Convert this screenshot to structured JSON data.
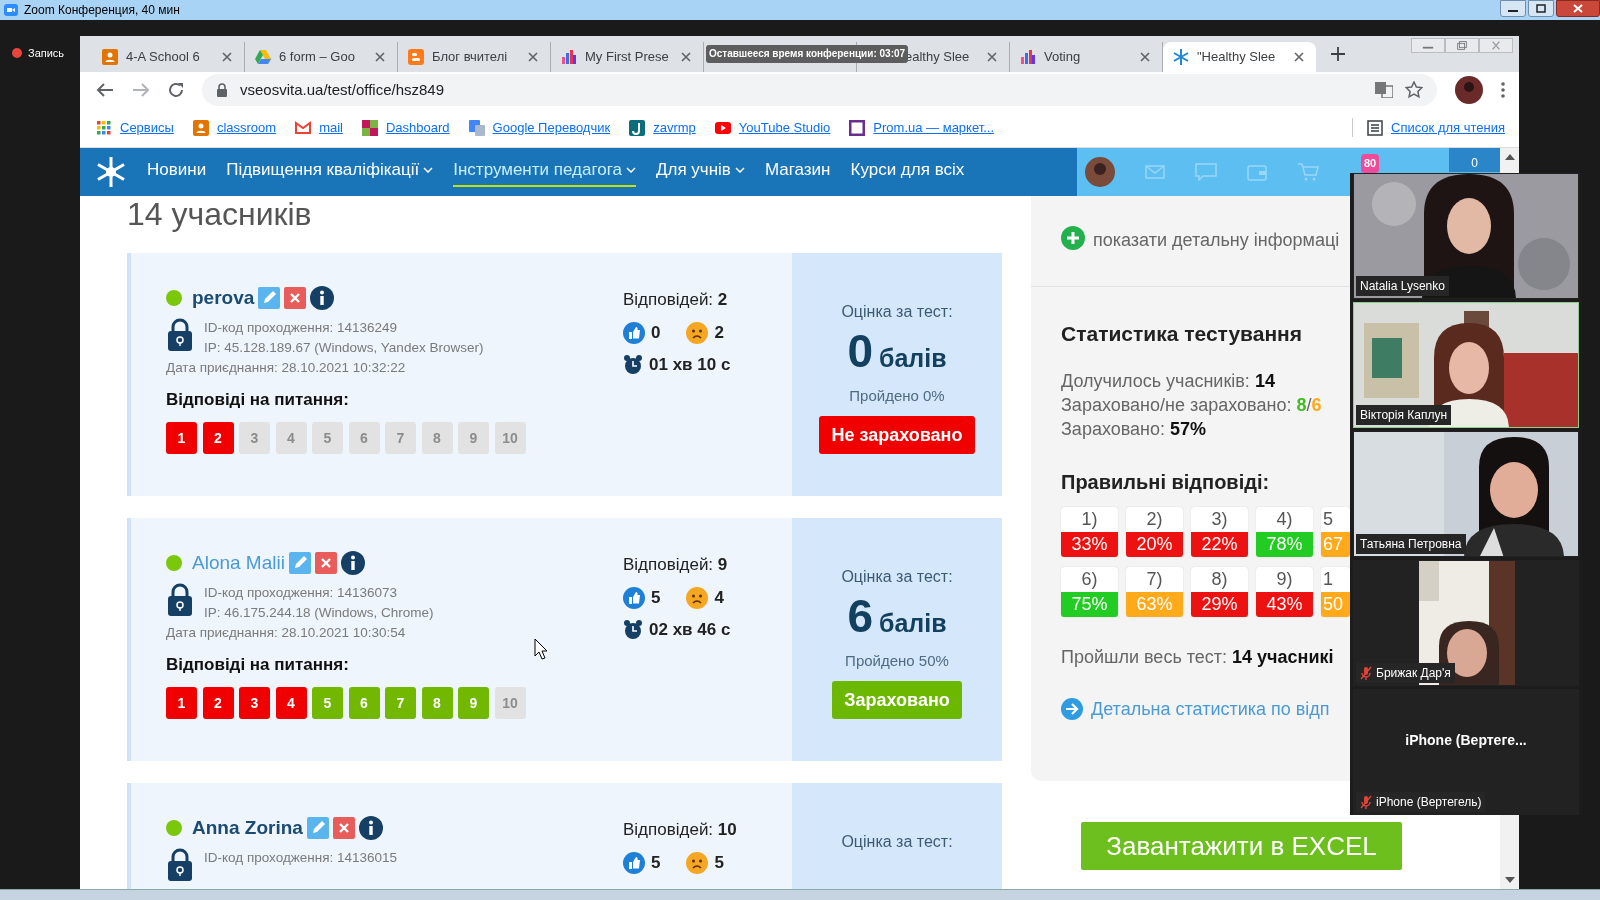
{
  "zoom_window": {
    "title": "Zoom Конференция, 40 мин",
    "recording": "Запись",
    "time_left": "Оставшееся время конференции: 03:07"
  },
  "browser": {
    "tabs": [
      {
        "kind": "classroom",
        "title": "4-A School 6",
        "selected": false
      },
      {
        "kind": "drive",
        "title": "6 form – Goo",
        "selected": false
      },
      {
        "kind": "blogger",
        "title": "Блог вчителі",
        "selected": false
      },
      {
        "kind": "chart",
        "title": "My First Prese",
        "selected": false
      },
      {
        "selected": false
      },
      {
        "title": "ealthy Slee",
        "selected": false
      },
      {
        "kind": "chart",
        "title": "Voting",
        "selected": false
      },
      {
        "kind": "snowflake",
        "title": "\"Healthy Slee",
        "selected": true
      }
    ],
    "address": "vseosvita.ua/test/office/hsz849",
    "bookmarks": [
      {
        "kind": "apps",
        "label": "Сервисы"
      },
      {
        "kind": "classroom",
        "label": "classroom"
      },
      {
        "kind": "gmail",
        "label": "mail"
      },
      {
        "kind": "dashboard",
        "label": "Dashboard"
      },
      {
        "kind": "translate",
        "label": "Google Переводчик"
      },
      {
        "kind": "zavrmp",
        "label": "zavrmp"
      },
      {
        "kind": "youtube",
        "label": "YouTube Studio"
      },
      {
        "kind": "prom",
        "label": "Prom.ua — маркет..."
      }
    ],
    "reading_list": "Список для чтения"
  },
  "site": {
    "nav": [
      {
        "label": "Новини",
        "dropdown": false,
        "selected": false
      },
      {
        "label": "Підвищення кваліфікації",
        "dropdown": true,
        "selected": false
      },
      {
        "label": "Інструменти педагога",
        "dropdown": true,
        "selected": true
      },
      {
        "label": "Для учнів",
        "dropdown": true,
        "selected": false
      },
      {
        "label": "Магазин",
        "dropdown": false,
        "selected": false
      },
      {
        "label": "Курси для всіх",
        "dropdown": false,
        "selected": false
      }
    ],
    "notifications": "80",
    "cart_count": "0"
  },
  "participants_heading": "14 учасників",
  "students": [
    {
      "name": "perova",
      "highlighted": false,
      "online": true,
      "id_code": "ID-код проходження: 14136249",
      "ip": "IP: 45.128.189.67 (Windows, Yandex Browser)",
      "joined": "Дата приєднання: 28.10.2021 10:32:22",
      "answers_label": "Відповіді на питання:",
      "questions": [
        {
          "label": "1",
          "kind": "wrong"
        },
        {
          "label": "2",
          "kind": "wrong"
        },
        {
          "label": "3",
          "kind": "none"
        },
        {
          "label": "4",
          "kind": "none"
        },
        {
          "label": "5",
          "kind": "none"
        },
        {
          "label": "6",
          "kind": "none"
        },
        {
          "label": "7",
          "kind": "none"
        },
        {
          "label": "8",
          "kind": "none"
        },
        {
          "label": "9",
          "kind": "none"
        },
        {
          "label": "10",
          "kind": "none"
        }
      ],
      "responses_label": "Відповідей:",
      "responses": "2",
      "likes": "0",
      "dislikes": "2",
      "time": "01 хв 10 с",
      "grade_label": "Оцінка за тест:",
      "score": "0",
      "score_unit": "балів",
      "passed": "Пройдено 0%",
      "verdict": {
        "label": "Не зараховано",
        "passed": false
      }
    },
    {
      "name": "Alona Malii",
      "highlighted": true,
      "online": true,
      "id_code": "ID-код проходження: 14136073",
      "ip": "IP: 46.175.244.18 (Windows, Chrome)",
      "joined": "Дата приєднання: 28.10.2021 10:30:54",
      "answers_label": "Відповіді на питання:",
      "questions": [
        {
          "label": "1",
          "kind": "wrong"
        },
        {
          "label": "2",
          "kind": "wrong"
        },
        {
          "label": "3",
          "kind": "wrong"
        },
        {
          "label": "4",
          "kind": "wrong"
        },
        {
          "label": "5",
          "kind": "correct"
        },
        {
          "label": "6",
          "kind": "correct"
        },
        {
          "label": "7",
          "kind": "correct"
        },
        {
          "label": "8",
          "kind": "correct"
        },
        {
          "label": "9",
          "kind": "correct"
        },
        {
          "label": "10",
          "kind": "none"
        }
      ],
      "responses_label": "Відповідей:",
      "responses": "9",
      "likes": "5",
      "dislikes": "4",
      "time": "02 хв 46 с",
      "grade_label": "Оцінка за тест:",
      "score": "6",
      "score_unit": "балів",
      "passed": "Пройдено 50%",
      "verdict": {
        "label": "Зараховано",
        "passed": true
      }
    },
    {
      "name": "Anna Zorina",
      "highlighted": false,
      "online": true,
      "id_code": "ID-код проходження: 14136015",
      "responses_label": "Відповідей:",
      "responses": "10",
      "likes": "5",
      "dislikes": "5",
      "grade_label": "Оцінка за тест:"
    }
  ],
  "sidebar": {
    "detail_link": "показати детальну інформаці",
    "stats_title": "Статистика тестування",
    "joined_label": "Долучилось учасників:",
    "joined": "14",
    "credit_label": "Зараховано/не зараховано:",
    "credited": "8",
    "separator": "/",
    "not_credited": "6",
    "credit_pct_label": "Зараховано:",
    "credit_pct": "57%",
    "correct_title": "Правильні відповіді:",
    "question_stats": [
      {
        "label": "1)",
        "value": "33%",
        "color": "#ee1111"
      },
      {
        "label": "2)",
        "value": "20%",
        "color": "#ee1111"
      },
      {
        "label": "3)",
        "value": "22%",
        "color": "#ee1111"
      },
      {
        "label": "4)",
        "value": "78%",
        "color": "#22cc22"
      },
      {
        "label": "5",
        "value": "67",
        "color": "#ffaa1a"
      },
      {
        "label": "6)",
        "value": "75%",
        "color": "#22cc22"
      },
      {
        "label": "7)",
        "value": "63%",
        "color": "#ffaa1a"
      },
      {
        "label": "8)",
        "value": "29%",
        "color": "#ee1111"
      },
      {
        "label": "9)",
        "value": "43%",
        "color": "#ee1111"
      },
      {
        "label": "1",
        "value": "50",
        "color": "#ffaa1a"
      }
    ],
    "completed_label": "Пройшли весь тест:",
    "completed": "14 учасникі",
    "detailed_link": "Детальна статистика по відп"
  },
  "excel_button": "Завантажити в EXCEL",
  "video_tiles": [
    {
      "name": "Natalia Lysenko",
      "kind": "video",
      "muted": false,
      "active_speaker": false
    },
    {
      "name": "Вікторія Каплун",
      "kind": "video",
      "muted": false,
      "active_speaker": true
    },
    {
      "name": "Татьяна Петровна",
      "kind": "video",
      "muted": false,
      "active_speaker": false
    },
    {
      "name": "Брижак Дар'я",
      "kind": "narrow_video",
      "muted": true,
      "active_speaker": false
    },
    {
      "name": "iPhone (Вертегель)",
      "kind": "no_video",
      "display": "iPhone  (Вертеге...",
      "muted": true,
      "active_speaker": false
    }
  ]
}
